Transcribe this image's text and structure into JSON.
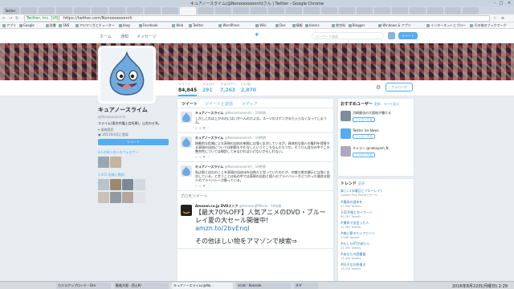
{
  "window": {
    "title": "キュアノースライム(@Nonoooooonnh)さん | Twitter - Google Chrome",
    "min": "–",
    "max": "□",
    "close": "×"
  },
  "tabs": [
    "Twitter",
    "",
    "",
    "",
    "",
    "",
    "",
    "",
    "",
    "",
    "",
    "",
    "",
    "",
    "",
    "",
    "",
    "",
    "",
    "",
    "",
    "",
    "",
    "",
    "",
    "",
    ""
  ],
  "address": {
    "secure_label": "Twitter, Inc. [US]",
    "url": "https://twitter.com/Nonoooooonnh"
  },
  "bookmarks": [
    "アプリ",
    "Google",
    "辞書",
    "SNS",
    "アロマンガとチューター",
    "blog",
    "Facebook",
    "Web",
    "Twitter",
    "WordPress",
    "Wiki",
    "Doc",
    "情報",
    "blocks",
    "航空料",
    "Blogger",
    "Windows & アプリ",
    "インターネットとブロー",
    "その他のブックマーク"
  ],
  "twnav": {
    "home": "ホーム",
    "notifications": "通知",
    "messages": "メッセージ",
    "search_placeholder": "キーワード検索",
    "tweet": "ツイート"
  },
  "stats": [
    {
      "label": "ツイート",
      "value": "84,845"
    },
    {
      "label": "フォロー",
      "value": "291"
    },
    {
      "label": "フォロワー",
      "value": "7,263"
    },
    {
      "label": "いいね",
      "value": "2,870"
    }
  ],
  "profile": {
    "follow": "フォロー中",
    "name": "キュアノースライム",
    "handle": "@Nonoooooonnh",
    "bio": "スライム(東京弁護士会所属)。山合わせ系。",
    "location": "東森県民",
    "joined": "2011年4月に登録",
    "tweet_to": "ツイート",
    "followers_you_know": "2人の知り合いのフォロワー",
    "photos": "1,072 画像と動画"
  },
  "timeline": {
    "tabs": [
      "ツイート",
      "ツイートと返信",
      "メディア"
    ],
    "tweets": [
      {
        "name": "キュアノースライム",
        "handle": "@Nonoooooonnh · 19時間",
        "text": "しかしこれは上がるのにはいかへんのだよな。スーツのズボンがまた入らなくなってしまうわ。"
      },
      {
        "name": "キュアノースライム",
        "handle": "@Nonoooooonnh · 19時間",
        "text": "抽象的な危険による表現の自由の制限には強く反対しているが、具体的な個人の権利を侵害する表現の自由については制限もやむなしというところなんだろうか。そうりん自分の中でこの整合性については検討してみなければいけないかもしれない。"
      },
      {
        "name": "キュアノースライム",
        "handle": "@Nonoooooonnh · 19時間",
        "text": "私は割と自分のことを表現の自由派を自負だと思っていたのだが、何度か差名開示には強く反対している。と言うことは私の中では表現の自由と個人のプライバシーがぶつかった場合は個人のプライバシーが勝っている。"
      }
    ],
    "acts": "↩  ⟲  ♥  ···",
    "promo_header": "プロモツイート",
    "promo": {
      "name": "Amazon.co.jp DVDストア",
      "handle": "@AmazonJPMovie · 10年間",
      "text": "【最大70%OFF】人気アニメのDVD・ブルーレイ夏の大セール開催中!",
      "link": "amzn.to/2bvEnql",
      "tail": "その他ほしい物をアマゾンで検索⇒"
    }
  },
  "suggest": {
    "title": "おすすめユーザー",
    "refresh": "更新 · すべて見る",
    "users": [
      {
        "name": "河崎隆也の大阪絵が書ける",
        "btn": "フォローする"
      },
      {
        "name": "Twitter Ice News",
        "btn": "フォローする"
      },
      {
        "name": "キャラン @nekoyam_N",
        "btn": "フォローする"
      }
    ]
  },
  "trends": {
    "title": "トレンド",
    "change": "変更",
    "items": [
      {
        "name": "楽しい(水曜日とブルーレイ)",
        "count": "Google Play Movieでセール"
      },
      {
        "name": "#最高の週末を",
        "count": "21,006 Tweets"
      },
      {
        "name": "天気予報とタイフーン",
        "count": "60,787 Tweets"
      },
      {
        "name": "#運命で出会った人",
        "count": "12,983 Tweets"
      },
      {
        "name": "#夜に聴きたいアニソン",
        "count": "7,066 Tweets"
      },
      {
        "name": "#もしもRTが来たら",
        "count": "22,393 Tweets"
      },
      {
        "name": "#あなたの読書量",
        "count": "13,300 Tweets"
      },
      {
        "name": "#好きなお絵描き",
        "count": "15,018 Tweets"
      }
    ]
  },
  "taskbar": {
    "items": [
      "カメラアップロード - Dro",
      "動画大阪 · 西土町",
      "キュアノースライム(@No...",
      "scrot - Konsole",
      "ネギ"
    ],
    "clock": "2016年8月22日(月曜日) 2:29"
  }
}
